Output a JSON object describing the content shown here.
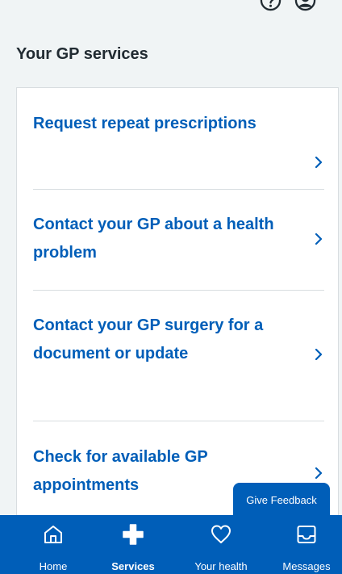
{
  "header": {
    "help_icon": "question-circle-icon",
    "account_icon": "account-circle-icon"
  },
  "section": {
    "title": "Your GP services"
  },
  "services": [
    {
      "label": "Request repeat prescriptions"
    },
    {
      "label": "Contact your GP about a health problem"
    },
    {
      "label": "Contact your GP surgery for a document or update"
    },
    {
      "label": "Check for available GP appointments"
    }
  ],
  "feedback": {
    "label": "Give Feedback"
  },
  "nav": {
    "items": [
      {
        "label": "Home",
        "icon": "home-icon",
        "active": false
      },
      {
        "label": "Services",
        "icon": "plus-icon",
        "active": true
      },
      {
        "label": "Your health",
        "icon": "heart-icon",
        "active": false
      },
      {
        "label": "Messages",
        "icon": "inbox-icon",
        "active": false
      }
    ]
  },
  "colors": {
    "brand_blue": "#005eb8",
    "page_background": "#f0f4f5",
    "card_background": "#ffffff",
    "text_dark": "#212b32",
    "divider": "#d8dde0"
  }
}
